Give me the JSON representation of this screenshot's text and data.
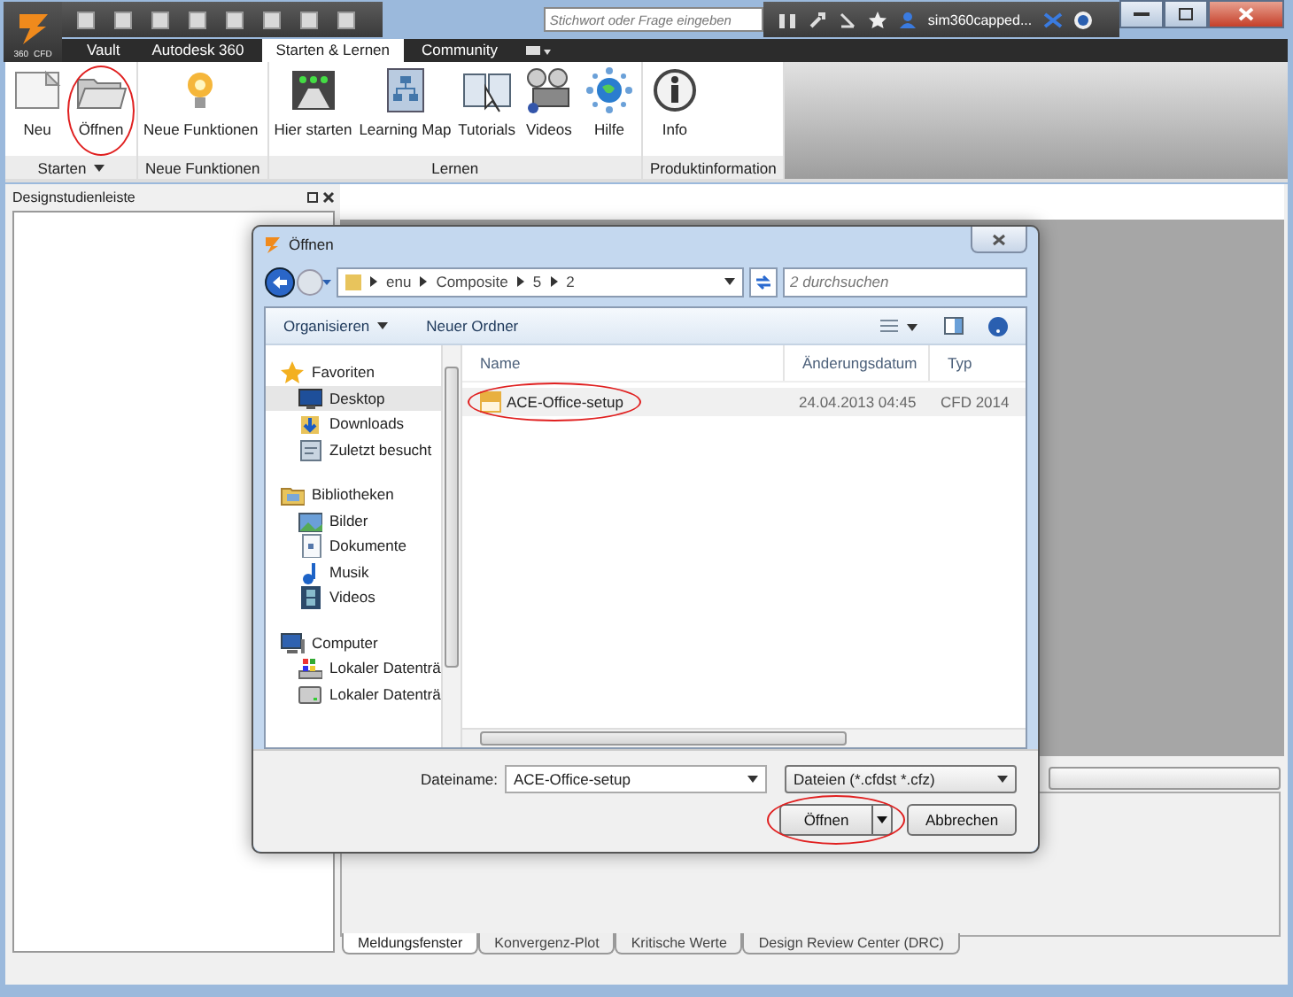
{
  "app": {
    "logo_labels": [
      "360",
      "CFD"
    ],
    "search": {
      "placeholder": "Stichwort oder Frage eingeben"
    },
    "user": "sim360capped..."
  },
  "tabs": [
    {
      "label": "Vault",
      "selected": false
    },
    {
      "label": "Autodesk 360",
      "selected": false
    },
    {
      "label": "Starten & Lernen",
      "selected": true
    },
    {
      "label": "Community",
      "selected": false
    }
  ],
  "ribbon_groups": [
    {
      "title": "Starten",
      "dropdown": true,
      "buttons": [
        {
          "label": "Neu",
          "circled": false
        },
        {
          "label": "Öffnen",
          "circled": true
        }
      ]
    },
    {
      "title": "Neue Funktionen",
      "dropdown": false,
      "buttons": [
        {
          "label": "Neue Funktionen",
          "circled": false
        }
      ]
    },
    {
      "title": "Lernen",
      "dropdown": false,
      "buttons": [
        {
          "label": "Hier starten",
          "circled": false
        },
        {
          "label": "Learning Map",
          "circled": false
        },
        {
          "label": "Tutorials",
          "circled": false
        },
        {
          "label": "Videos",
          "circled": false
        },
        {
          "label": "Hilfe",
          "circled": false
        }
      ]
    },
    {
      "title": "Produktinformation",
      "dropdown": false,
      "buttons": [
        {
          "label": "Info",
          "circled": false
        }
      ]
    }
  ],
  "panel": {
    "title": "Designstudienleiste"
  },
  "bottom_tabs": [
    {
      "label": "Meldungsfenster",
      "selected": true
    },
    {
      "label": "Konvergenz-Plot",
      "selected": false
    },
    {
      "label": "Kritische Werte",
      "selected": false
    },
    {
      "label": "Design Review Center (DRC)",
      "selected": false
    }
  ],
  "dialog": {
    "title": "Öffnen",
    "breadcrumb": [
      "enu",
      "Composite",
      "5",
      "2"
    ],
    "search": {
      "placeholder": "2 durchsuchen"
    },
    "toolbar": [
      {
        "label": "Organisieren",
        "dropdown": true
      },
      {
        "label": "Neuer Ordner",
        "dropdown": false
      }
    ],
    "nav": [
      {
        "label": "Favoriten",
        "selected": false,
        "children": [
          {
            "label": "Desktop",
            "selected": true
          },
          {
            "label": "Downloads",
            "selected": false
          },
          {
            "label": "Zuletzt besucht",
            "selected": false
          }
        ]
      },
      {
        "label": "Bibliotheken",
        "selected": false,
        "children": [
          {
            "label": "Bilder",
            "selected": false
          },
          {
            "label": "Dokumente",
            "selected": false
          },
          {
            "label": "Musik",
            "selected": false
          },
          {
            "label": "Videos",
            "selected": false
          }
        ]
      },
      {
        "label": "Computer",
        "selected": false,
        "children": [
          {
            "label": "Lokaler Datenträ",
            "selected": false
          },
          {
            "label": "Lokaler Datenträ",
            "selected": false
          }
        ]
      }
    ],
    "columns": [
      "Name",
      "Änderungsdatum",
      "Typ"
    ],
    "files": [
      {
        "name": "ACE-Office-setup",
        "date": "24.04.2013 04:45",
        "type": "CFD 2014",
        "circled": true
      }
    ],
    "filename_label": "Dateiname:",
    "filename": "ACE-Office-setup",
    "filter": "Dateien (*.cfdst *.cfz)",
    "buttons": [
      {
        "label": "Öffnen",
        "kind": "split",
        "circled": true
      },
      {
        "label": "Abbrechen",
        "kind": "plain",
        "circled": false
      }
    ]
  }
}
